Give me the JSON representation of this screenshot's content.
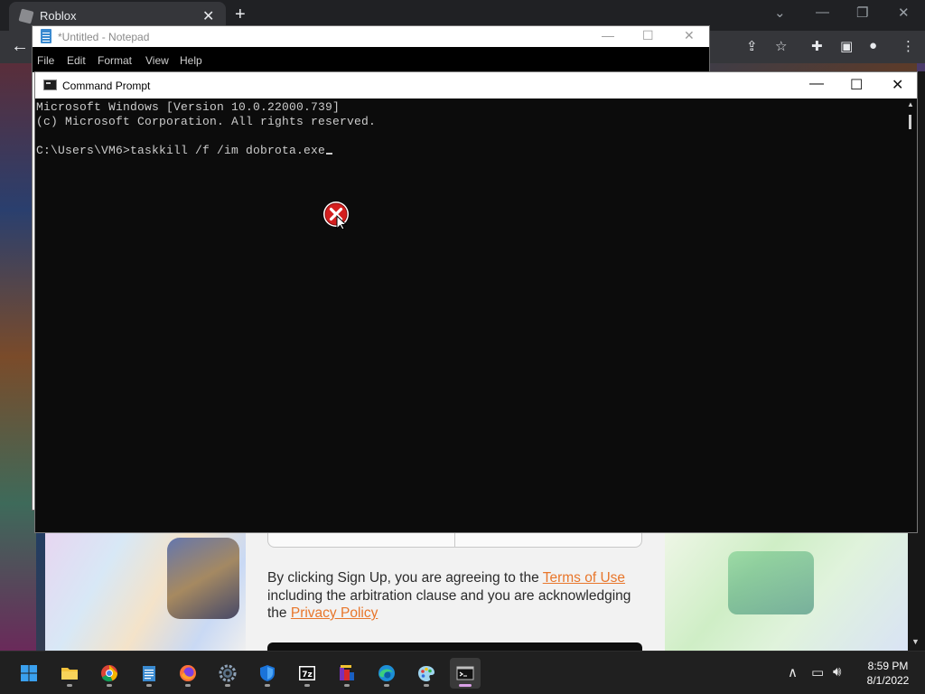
{
  "chrome": {
    "tab_title": "Roblox",
    "close_tab_glyph": "✕",
    "new_tab_glyph": "+",
    "back_glyph": "←"
  },
  "roblox": {
    "terms_prefix": "By clicking Sign Up, you are agreeing to the ",
    "terms_link": "Terms of Use",
    "terms_middle": " including the arbitration clause and you are acknowledging the ",
    "privacy_link": "Privacy Policy",
    "link_color": "#e8762b"
  },
  "notepad": {
    "title": "*Untitled - Notepad",
    "menu": [
      "File",
      "Edit",
      "Format",
      "View",
      "Help"
    ]
  },
  "cmd": {
    "title": "Command Prompt",
    "lines": [
      "Microsoft Windows [Version 10.0.22000.739]",
      "(c) Microsoft Corporation. All rights reserved.",
      "",
      "C:\\Users\\VM6>taskkill /f /im dobrota.exe"
    ]
  },
  "taskbar": {
    "apps": [
      "start-icon",
      "file-explorer-icon",
      "chrome-icon",
      "notepad-icon",
      "firefox-icon",
      "settings-icon",
      "windows-security-icon",
      "7zip-icon",
      "winrar-icon",
      "edge-icon",
      "paint-icon",
      "command-prompt-icon"
    ],
    "time": "8:59 PM",
    "date": "8/1/2022"
  },
  "colors": {
    "accent_cmd": "#0c0c0c",
    "taskbar": "#202020"
  }
}
